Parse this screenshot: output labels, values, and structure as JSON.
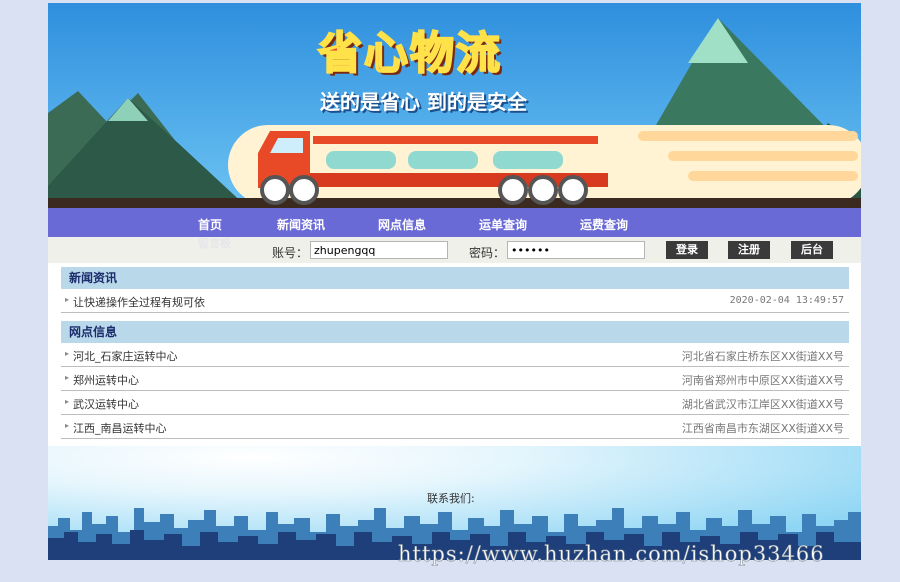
{
  "banner": {
    "title": "省心物流",
    "slogan": "送的是省心 到的是安全"
  },
  "nav": {
    "items": [
      "首页",
      "新闻资讯",
      "网点信息",
      "运单查询",
      "运费查询"
    ],
    "hidden_item": "留言板"
  },
  "login": {
    "account_label": "账号：",
    "account_value": "zhupengqq",
    "password_label": "密码：",
    "password_value": "••••••",
    "login_button": "登录",
    "register_button": "注册",
    "admin_button": "后台"
  },
  "news": {
    "heading": "新闻资讯",
    "items": [
      {
        "title": "让快递操作全过程有规可依",
        "date": "2020-02-04 13:49:57"
      }
    ]
  },
  "outlets": {
    "heading": "网点信息",
    "items": [
      {
        "name": "河北_石家庄运转中心",
        "address": "河北省石家庄桥东区XX街道XX号"
      },
      {
        "name": "郑州运转中心",
        "address": "河南省郑州市中原区XX街道XX号"
      },
      {
        "name": "武汉运转中心",
        "address": "湖北省武汉市江岸区XX街道XX号"
      },
      {
        "name": "江西_南昌运转中心",
        "address": "江西省南昌市东湖区XX街道XX号"
      }
    ]
  },
  "footer": {
    "contact_label": "联系我们:"
  },
  "watermark": "https://www.huzhan.com/ishop33466",
  "colors": {
    "nav_bg": "#6a6ad6",
    "section_header_bg": "#b9d9ea",
    "page_bg": "#d9e1f2"
  }
}
